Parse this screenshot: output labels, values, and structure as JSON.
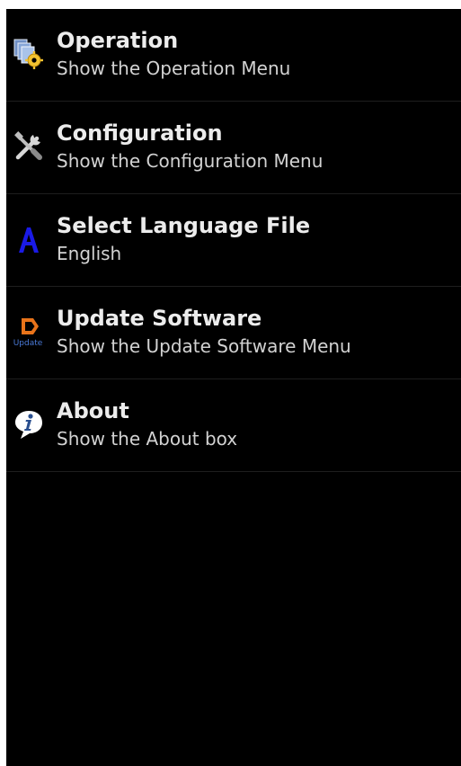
{
  "menu": {
    "items": [
      {
        "title": "Operation",
        "subtitle": "Show the Operation Menu",
        "icon": "operation-icon"
      },
      {
        "title": "Configuration",
        "subtitle": "Show the Configuration Menu",
        "icon": "tools-icon"
      },
      {
        "title": "Select Language File",
        "subtitle": "English",
        "icon": "language-icon"
      },
      {
        "title": "Update Software",
        "subtitle": "Show the Update Software Menu",
        "icon": "update-icon"
      },
      {
        "title": "About",
        "subtitle": "Show the About box",
        "icon": "info-icon"
      }
    ],
    "update_icon_caption": "Update"
  },
  "colors": {
    "background": "#000000",
    "divider": "#1e1e1e",
    "language_icon": "#1a1ae6",
    "update_icon": "#e8731a"
  }
}
